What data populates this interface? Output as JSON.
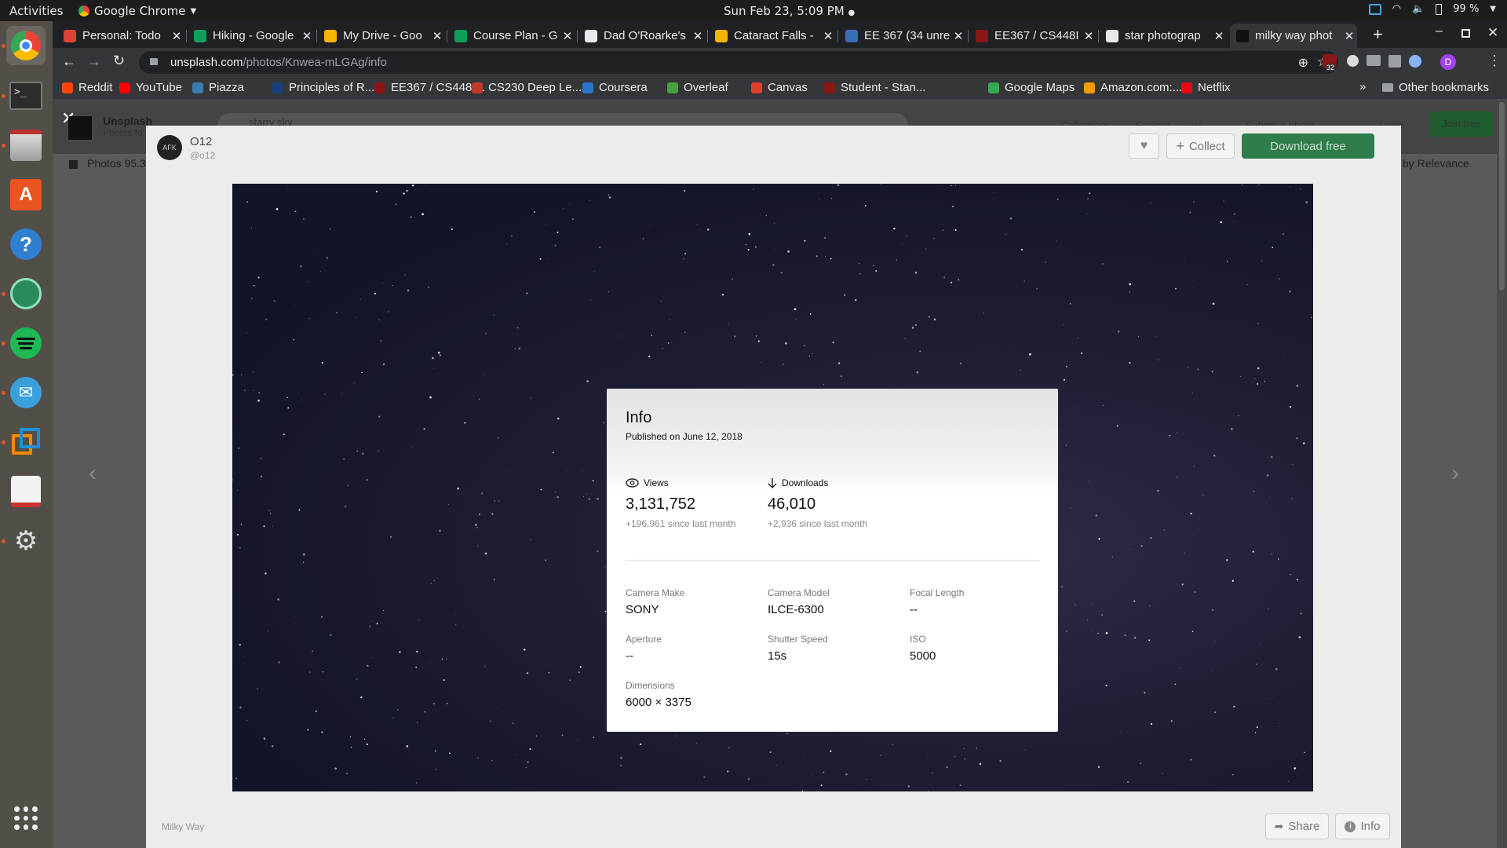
{
  "os": {
    "activities": "Activities",
    "app_name": "Google Chrome",
    "clock": "Sun Feb 23,  5:09 PM",
    "battery": "99 %"
  },
  "tabs": [
    {
      "title": "Personal: Todo",
      "color": "#db4437"
    },
    {
      "title": "Hiking - Google",
      "color": "#0f9d58"
    },
    {
      "title": "My Drive - Goo",
      "color": "#f4b400"
    },
    {
      "title": "Course Plan - G",
      "color": "#0f9d58"
    },
    {
      "title": "Dad O'Roarke's",
      "color": "#e8eaed"
    },
    {
      "title": "Cataract Falls -",
      "color": "#f4b400"
    },
    {
      "title": "EE 367 (34 unre",
      "color": "#3b6db5"
    },
    {
      "title": "EE367 / CS448I",
      "color": "#8c1515"
    },
    {
      "title": "star photograp",
      "color": "#e8eaed"
    },
    {
      "title": "milky way phot",
      "color": "#111111"
    }
  ],
  "url": {
    "host": "unsplash.com",
    "path": "/photos/Knwea-mLGAg/info"
  },
  "extension_badge": "32",
  "profile_initial": "D",
  "bookmarks": [
    {
      "label": "Reddit",
      "color": "#ff4500"
    },
    {
      "label": "YouTube",
      "color": "#ff0000"
    },
    {
      "label": "Piazza",
      "color": "#3e7aab"
    },
    {
      "label": "Principles of R...",
      "color": "#1a3d7c"
    },
    {
      "label": "EE367 / CS448I...",
      "color": "#8c1515"
    },
    {
      "label": "CS230 Deep Le...",
      "color": "#c0392b"
    },
    {
      "label": "Coursera",
      "color": "#2a73cc"
    },
    {
      "label": "Overleaf",
      "color": "#47a141"
    },
    {
      "label": "Canvas",
      "color": "#e13f29"
    },
    {
      "label": "Student - Stan...",
      "color": "#8c1515"
    },
    {
      "label": "Google Maps",
      "color": "#34a853"
    },
    {
      "label": "Amazon.com:...",
      "color": "#ff9900"
    },
    {
      "label": "Netflix",
      "color": "#e50914"
    }
  ],
  "other_bookmarks": "Other bookmarks",
  "bg": {
    "brand": "Unsplash",
    "tagline": "Photos fo",
    "search": "starry sky",
    "nav": [
      "Collections",
      "Explore",
      "•••"
    ],
    "submit": "Submit a photo",
    "login": "Login",
    "join": "Join free",
    "photos_count": "Photos 95.3",
    "sort": "by Relevance"
  },
  "photo": {
    "author_name": "O12",
    "author_handle": "@o12",
    "avatar_text": "AFK",
    "collect": "Collect",
    "download": "Download free",
    "caption": "Milky Way",
    "share": "Share",
    "info": "Info"
  },
  "info": {
    "title": "Info",
    "published": "Published on June 12, 2018",
    "views_label": "Views",
    "views": "3,131,752",
    "views_delta": "+196,961 since last month",
    "downloads_label": "Downloads",
    "downloads": "46,010",
    "downloads_delta": "+2,936 since last month",
    "specs": [
      {
        "label": "Camera Make",
        "value": "SONY"
      },
      {
        "label": "Camera Model",
        "value": "ILCE-6300"
      },
      {
        "label": "Focal Length",
        "value": "--"
      },
      {
        "label": "Aperture",
        "value": "--"
      },
      {
        "label": "Shutter Speed",
        "value": "15s"
      },
      {
        "label": "ISO",
        "value": "5000"
      },
      {
        "label": "Dimensions",
        "value": "6000 × 3375"
      }
    ]
  }
}
